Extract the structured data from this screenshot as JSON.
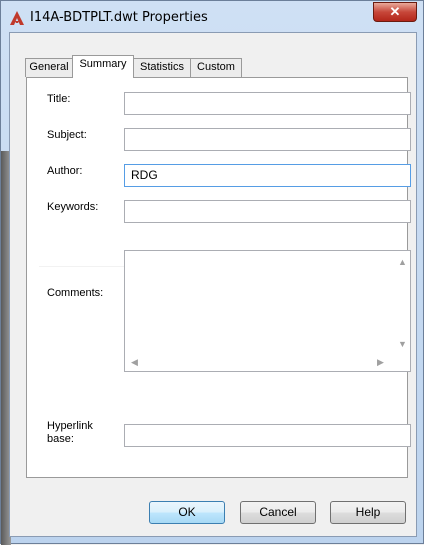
{
  "window": {
    "title": "I14A-BDTPLT.dwt Properties",
    "close_glyph": "✕",
    "app_icon": "autocad-logo-icon",
    "accent": "#c0392b"
  },
  "tabs": [
    {
      "label": "General"
    },
    {
      "label": "Summary",
      "active": true
    },
    {
      "label": "Statistics"
    },
    {
      "label": "Custom"
    }
  ],
  "fields": {
    "title": {
      "label": "Title:",
      "value": ""
    },
    "subject": {
      "label": "Subject:",
      "value": ""
    },
    "author": {
      "label": "Author:",
      "value": "RDG"
    },
    "keywords": {
      "label": "Keywords:",
      "value": ""
    },
    "comments": {
      "label": "Comments:",
      "value": ""
    },
    "hyperlink": {
      "label_line1": "Hyperlink",
      "label_line2": "base:",
      "value": ""
    }
  },
  "buttons": {
    "ok": "OK",
    "cancel": "Cancel",
    "help": "Help"
  }
}
